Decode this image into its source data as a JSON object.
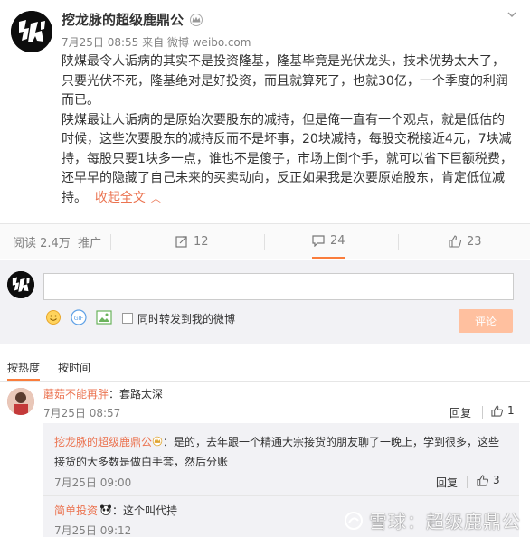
{
  "post": {
    "author": "挖龙脉的超级鹿鼎公",
    "meta": "7月25日 08:55 来自 微博 weibo.com",
    "paragraph1": "陕煤最令人诟病的其实不是投资隆基，隆基毕竟是光伏龙头，技术优势太大了，只要光伏不死，隆基绝对是好投资，而且就算死了，也就30亿，一个季度的利润而已。",
    "paragraph2": "陕煤最让人诟病的是原始次要股东的减持，但是俺一直有一个观点，就是低估的时候，这些次要股东的减持反而不是坏事，20块减持，每股交税接近4元，7块减持，每股只要1块多一点，谁也不是傻子，市场上倒个手，就可以省下巨额税费，还早早的隐藏了自己未来的买卖动向，反正如果我是次要原始股东，肯定低位减持。",
    "fold_label": "收起全文",
    "fold_caret": "︿"
  },
  "actionbar": {
    "reads": "阅读 2.4万",
    "promote": "推广",
    "repost_count": "12",
    "comment_count": "24",
    "like_count": "23"
  },
  "composer": {
    "input_value": "",
    "forward_label": "同时转发到我的微博",
    "submit_label": "评论"
  },
  "sort": {
    "hot": "按热度",
    "time": "按时间"
  },
  "comments": [
    {
      "name": "蘑菇不能再胖",
      "text": "：套路太深",
      "time": "7月25日 08:57",
      "reply": "回复",
      "likes": "1"
    }
  ],
  "subcomments": [
    {
      "name": "挖龙脉的超级鹿鼎公",
      "text": "：是的，去年跟一个精通大宗接货的朋友聊了一晚上，学到很多，这些接货的大多数是做白手套，然后分账",
      "time": "7月25日 09:00",
      "reply": "回复",
      "likes": "3"
    },
    {
      "name": "简单投资",
      "text": "：这个叫代持",
      "time": "7月25日 09:12"
    }
  ],
  "watermark": "雪球：超级鹿鼎公",
  "colors": {
    "accent": "#eb7350",
    "submit_disabled": "#ffc09f",
    "tab_underline": "#fa7d3c"
  }
}
